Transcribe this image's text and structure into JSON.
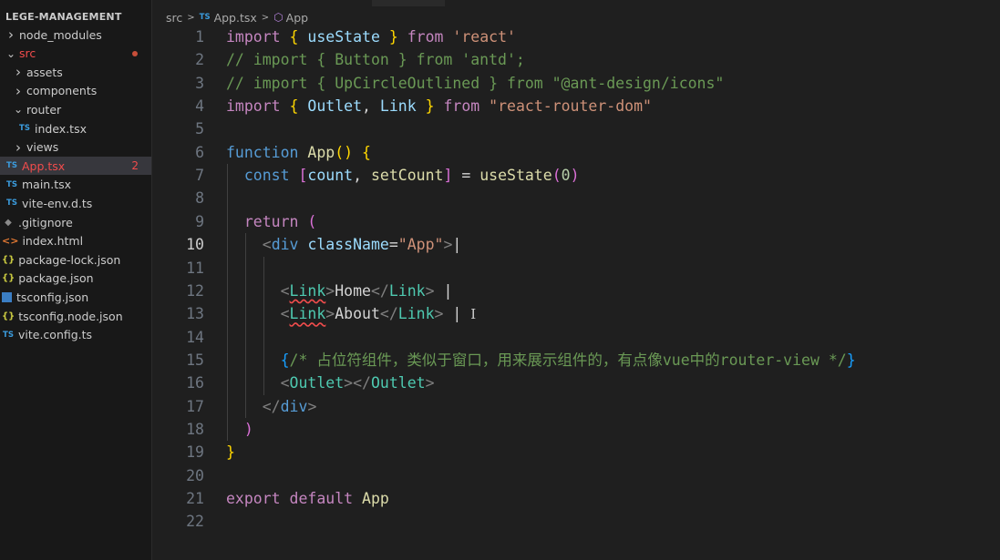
{
  "explorer": {
    "title": "LEGE-MANAGEMENT",
    "items": [
      {
        "label": "node_modules",
        "kind": "folder",
        "expanded": false
      },
      {
        "label": "src",
        "kind": "folder",
        "expanded": true,
        "modified": true
      },
      {
        "label": "assets",
        "kind": "folder",
        "expanded": false
      },
      {
        "label": "components",
        "kind": "folder",
        "expanded": false
      },
      {
        "label": "router",
        "kind": "folder",
        "expanded": true
      },
      {
        "label": "index.tsx",
        "kind": "ts"
      },
      {
        "label": "views",
        "kind": "folder",
        "expanded": false
      },
      {
        "label": "App.tsx",
        "kind": "ts",
        "selected": true,
        "errors": "2"
      },
      {
        "label": "main.tsx",
        "kind": "ts"
      },
      {
        "label": "vite-env.d.ts",
        "kind": "ts"
      },
      {
        "label": ".gitignore",
        "kind": "git"
      },
      {
        "label": "index.html",
        "kind": "html"
      },
      {
        "label": "package-lock.json",
        "kind": "json"
      },
      {
        "label": "package.json",
        "kind": "json"
      },
      {
        "label": "tsconfig.json",
        "kind": "tsconfig"
      },
      {
        "label": "tsconfig.node.json",
        "kind": "json"
      },
      {
        "label": "vite.config.ts",
        "kind": "ts"
      }
    ],
    "icon_text": {
      "ts": "TS",
      "json": "{}",
      "html": "<>",
      "git": "◆"
    }
  },
  "breadcrumb": {
    "folder": "src",
    "file": "App.tsx",
    "symbol": "App",
    "file_icon": "TS"
  },
  "editor": {
    "current_line": 10,
    "line_numbers": [
      "1",
      "2",
      "3",
      "4",
      "5",
      "6",
      "7",
      "8",
      "9",
      "10",
      "11",
      "12",
      "13",
      "14",
      "15",
      "16",
      "17",
      "18",
      "19",
      "20",
      "21",
      "22"
    ],
    "lines": [
      [
        [
          "kw",
          "import"
        ],
        [
          "pun",
          " "
        ],
        [
          "br1",
          "{"
        ],
        [
          "pun",
          " "
        ],
        [
          "var",
          "useState"
        ],
        [
          "pun",
          " "
        ],
        [
          "br1",
          "}"
        ],
        [
          "pun",
          " "
        ],
        [
          "kw",
          "from"
        ],
        [
          "pun",
          " "
        ],
        [
          "str",
          "'react'"
        ]
      ],
      [
        [
          "cmt",
          "// import { Button } from 'antd';"
        ]
      ],
      [
        [
          "cmt",
          "// import { UpCircleOutlined } from \"@ant-design/icons\""
        ]
      ],
      [
        [
          "kw",
          "import"
        ],
        [
          "pun",
          " "
        ],
        [
          "br1",
          "{"
        ],
        [
          "pun",
          " "
        ],
        [
          "var",
          "Outlet"
        ],
        [
          "pun",
          ", "
        ],
        [
          "var",
          "Link"
        ],
        [
          "pun",
          " "
        ],
        [
          "br1",
          "}"
        ],
        [
          "pun",
          " "
        ],
        [
          "kw",
          "from"
        ],
        [
          "pun",
          " "
        ],
        [
          "str",
          "\"react-router-dom\""
        ]
      ],
      [],
      [
        [
          "kwb",
          "function"
        ],
        [
          "pun",
          " "
        ],
        [
          "fn",
          "App"
        ],
        [
          "br1",
          "()"
        ],
        [
          "pun",
          " "
        ],
        [
          "br1",
          "{"
        ]
      ],
      [
        [
          "pun",
          "  "
        ],
        [
          "kwb",
          "const"
        ],
        [
          "pun",
          " "
        ],
        [
          "br2",
          "["
        ],
        [
          "var",
          "count"
        ],
        [
          "pun",
          ", "
        ],
        [
          "fn",
          "setCount"
        ],
        [
          "br2",
          "]"
        ],
        [
          "pun",
          " = "
        ],
        [
          "fn",
          "useState"
        ],
        [
          "br2",
          "("
        ],
        [
          "num",
          "0"
        ],
        [
          "br2",
          ")"
        ]
      ],
      [],
      [
        [
          "pun",
          "  "
        ],
        [
          "kw",
          "return"
        ],
        [
          "pun",
          " "
        ],
        [
          "br2",
          "("
        ]
      ],
      [
        [
          "pun",
          "    "
        ],
        [
          "tagb",
          "<"
        ],
        [
          "tag",
          "div"
        ],
        [
          "pun",
          " "
        ],
        [
          "attr",
          "className"
        ],
        [
          "pun",
          "="
        ],
        [
          "str",
          "\"App\""
        ],
        [
          "tagb",
          ">"
        ],
        [
          "caret-txt",
          "|"
        ]
      ],
      [],
      [
        [
          "pun",
          "      "
        ],
        [
          "tagb",
          "<"
        ],
        [
          "comp squig",
          "Link"
        ],
        [
          "tagb",
          ">"
        ],
        [
          "pun",
          "Home"
        ],
        [
          "tagb",
          "</"
        ],
        [
          "comp",
          "Link"
        ],
        [
          "tagb",
          ">"
        ],
        [
          "pun",
          " |"
        ]
      ],
      [
        [
          "pun",
          "      "
        ],
        [
          "tagb",
          "<"
        ],
        [
          "comp squig",
          "Link"
        ],
        [
          "tagb",
          ">"
        ],
        [
          "pun",
          "About"
        ],
        [
          "tagb",
          "</"
        ],
        [
          "comp",
          "Link"
        ],
        [
          "tagb",
          ">"
        ],
        [
          "pun",
          " |"
        ],
        [
          "pun",
          " "
        ],
        [
          "ibeam",
          "I"
        ]
      ],
      [],
      [
        [
          "pun",
          "      "
        ],
        [
          "br3",
          "{"
        ],
        [
          "cmt",
          "/* 占位符组件，类似于窗口，用来展示组件的，有点像vue中的router-view */"
        ],
        [
          "br3",
          "}"
        ]
      ],
      [
        [
          "pun",
          "      "
        ],
        [
          "tagb",
          "<"
        ],
        [
          "comp",
          "Outlet"
        ],
        [
          "tagb",
          "></"
        ],
        [
          "comp",
          "Outlet"
        ],
        [
          "tagb",
          ">"
        ]
      ],
      [
        [
          "pun",
          "    "
        ],
        [
          "tagb",
          "</"
        ],
        [
          "tag",
          "div"
        ],
        [
          "tagb",
          ">"
        ]
      ],
      [
        [
          "pun",
          "  "
        ],
        [
          "br2",
          ")"
        ]
      ],
      [
        [
          "br1",
          "}"
        ]
      ],
      [],
      [
        [
          "kw",
          "export"
        ],
        [
          "pun",
          " "
        ],
        [
          "kw",
          "default"
        ],
        [
          "pun",
          " "
        ],
        [
          "fn",
          "App"
        ]
      ],
      []
    ]
  },
  "colors": {
    "sidebar_bg": "#181818",
    "editor_bg": "#1f1f1f",
    "selected_row": "#37373d",
    "error_red": "#f14c4c",
    "ts_blue": "#3b9cde",
    "json_yellow": "#cbcb41"
  }
}
